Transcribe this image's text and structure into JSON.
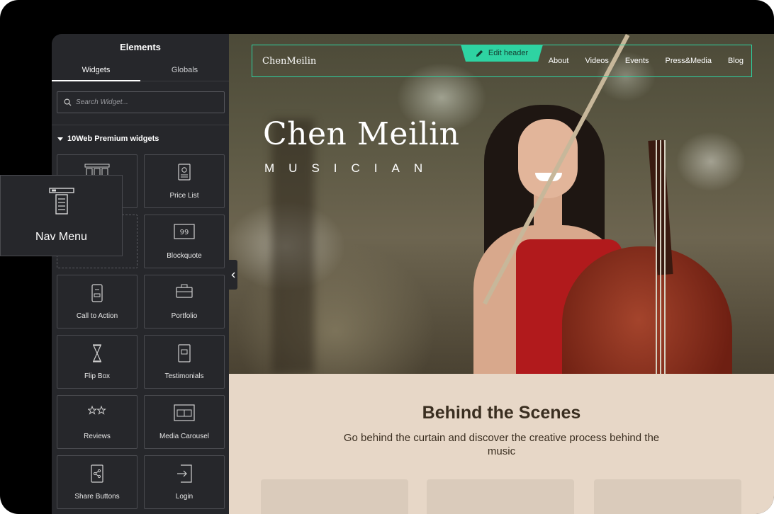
{
  "panel": {
    "title": "Elements",
    "tabs": [
      {
        "label": "Widgets",
        "active": true
      },
      {
        "label": "Globals",
        "active": false
      }
    ],
    "search_placeholder": "Search Widget...",
    "category": "10Web Premium widgets",
    "widgets": [
      {
        "label": "",
        "icon": "nav-menu-icon"
      },
      {
        "label": "Price List",
        "icon": "price-list-icon"
      },
      {
        "label": "",
        "icon": "placeholder"
      },
      {
        "label": "Blockquote",
        "icon": "blockquote-icon"
      },
      {
        "label": "Call to Action",
        "icon": "call-to-action-icon"
      },
      {
        "label": "Portfolio",
        "icon": "portfolio-icon"
      },
      {
        "label": "Flip Box",
        "icon": "flip-box-icon"
      },
      {
        "label": "Testimonials",
        "icon": "testimonials-icon"
      },
      {
        "label": "Reviews",
        "icon": "reviews-icon"
      },
      {
        "label": "Media Carousel",
        "icon": "media-carousel-icon"
      },
      {
        "label": "Share Buttons",
        "icon": "share-buttons-icon"
      },
      {
        "label": "Login",
        "icon": "login-icon"
      }
    ],
    "drag_item": {
      "label": "Nav Menu",
      "icon": "nav-menu-icon"
    }
  },
  "site": {
    "logo": "ChenMeilin",
    "edit_header_label": "Edit header",
    "nav": [
      "About",
      "Videos",
      "Events",
      "Press&Media",
      "Blog"
    ],
    "hero_title": "Chen Meilin",
    "hero_subtitle": "MUSICIAN",
    "section_title": "Behind the Scenes",
    "section_text": "Go behind the curtain and discover the creative process behind the music"
  },
  "colors": {
    "accent": "#2ed3a2",
    "panel_bg": "#26272b",
    "section_bg": "#e7d7c7"
  }
}
